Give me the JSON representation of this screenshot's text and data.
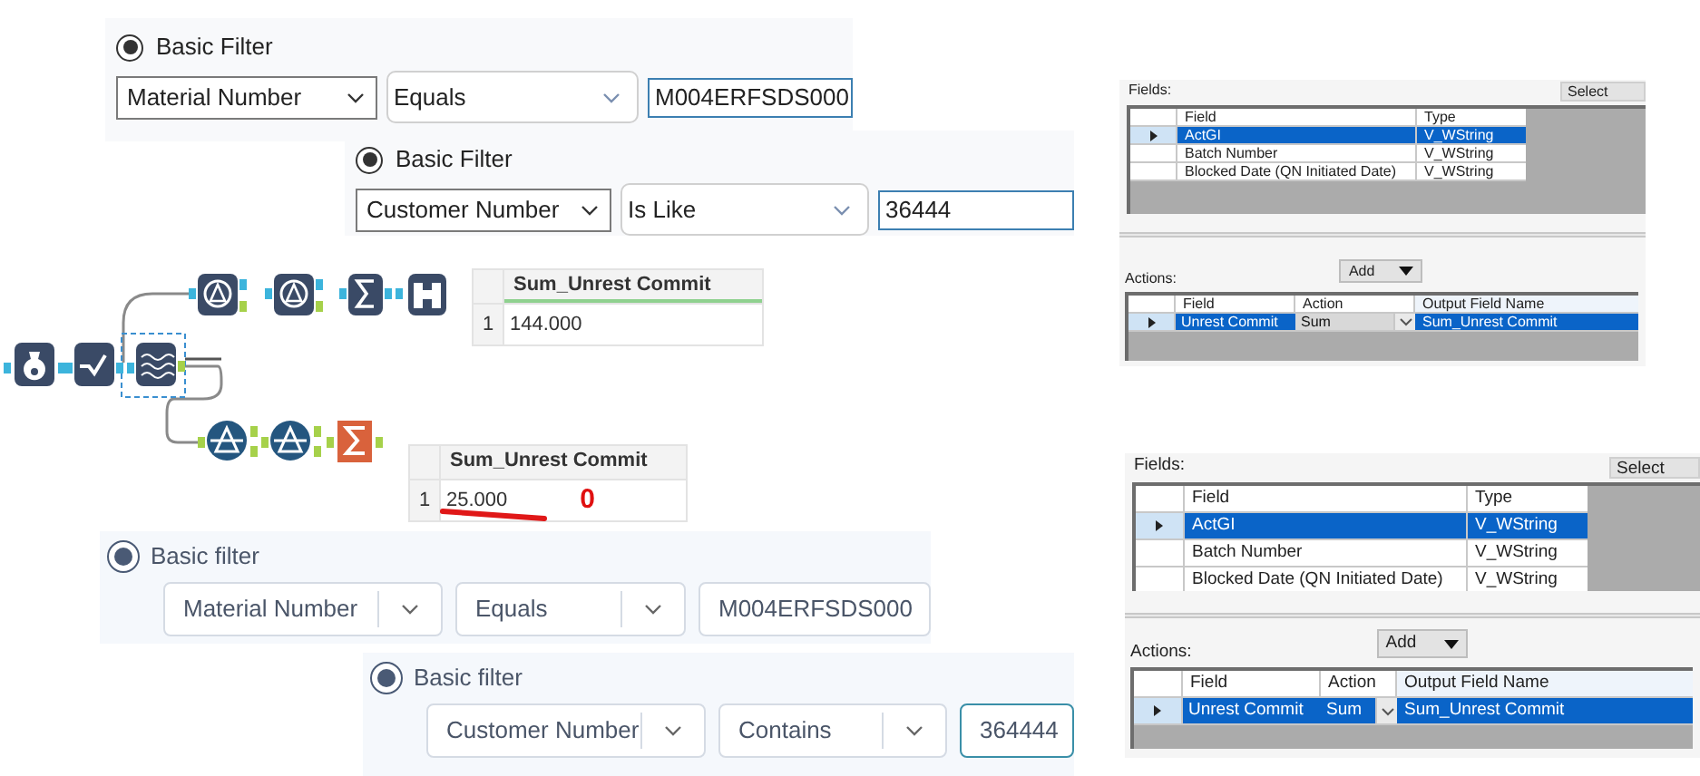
{
  "filters": [
    {
      "kind": "classic",
      "label": "Basic Filter",
      "selected": true,
      "field": "Material Number",
      "operator": "Equals",
      "value": "M004ERFSDS000"
    },
    {
      "kind": "classic",
      "label": "Basic Filter",
      "selected": true,
      "field": "Customer Number",
      "operator": "Is Like",
      "value": "36444"
    },
    {
      "kind": "modern",
      "label": "Basic filter",
      "selected": true,
      "field": "Material Number",
      "operator": "Equals",
      "value": "M004ERFSDS000"
    },
    {
      "kind": "modern",
      "label": "Basic filter",
      "selected": true,
      "field": "Customer Number",
      "operator": "Contains",
      "value": "364444"
    }
  ],
  "results": [
    {
      "column": "Sum_Unrest Commit",
      "rows": [
        {
          "index": "1",
          "value": "144.000",
          "struck": false
        }
      ]
    },
    {
      "column": "Sum_Unrest Commit",
      "rows": [
        {
          "index": "1",
          "value": "25.000",
          "struck": true
        }
      ],
      "annotation": "0"
    }
  ],
  "summarize_panels": [
    {
      "select_button": "Select",
      "fields_label": "Fields:",
      "fields_columns": [
        "Field",
        "Type"
      ],
      "fields": [
        {
          "name": "ActGI",
          "type": "V_WString",
          "selected": true
        },
        {
          "name": "Batch Number",
          "type": "V_WString",
          "selected": false
        },
        {
          "name": "Blocked Date (QN Initiated Date)",
          "type": "V_WString",
          "selected": false
        }
      ],
      "actions_label": "Actions:",
      "add_button": "Add",
      "actions_columns": [
        "Field",
        "Action",
        "Output Field Name"
      ],
      "actions": [
        {
          "field": "Unrest Commit",
          "action": "Sum",
          "output": "Sum_Unrest Commit",
          "selected": true
        }
      ]
    },
    {
      "select_button": "Select",
      "fields_label": "Fields:",
      "fields_columns": [
        "Field",
        "Type"
      ],
      "fields": [
        {
          "name": "ActGI",
          "type": "V_WString",
          "selected": true
        },
        {
          "name": "Batch Number",
          "type": "V_WString",
          "selected": false
        },
        {
          "name": "Blocked Date (QN Initiated Date)",
          "type": "V_WString",
          "selected": false
        }
      ],
      "actions_label": "Actions:",
      "add_button": "Add",
      "actions_columns": [
        "Field",
        "Action",
        "Output Field Name"
      ],
      "actions": [
        {
          "field": "Unrest Commit",
          "action": "Sum",
          "output": "Sum_Unrest Commit",
          "selected": true
        }
      ]
    }
  ]
}
